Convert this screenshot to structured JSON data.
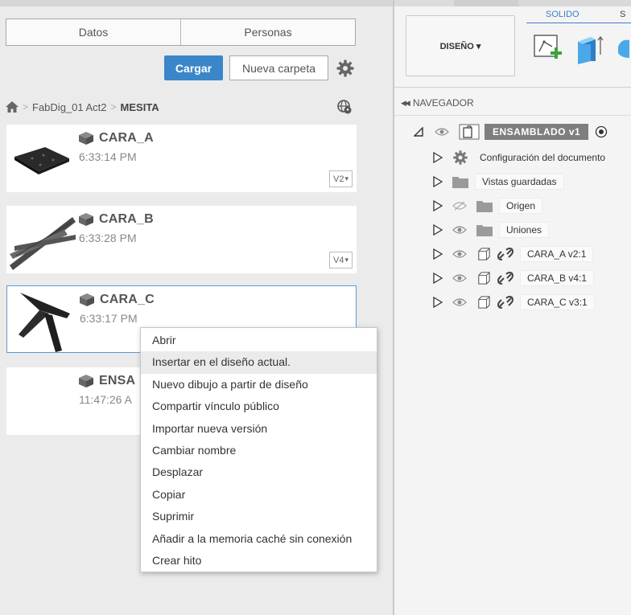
{
  "left_panel": {
    "tabs": [
      {
        "label": "Datos"
      },
      {
        "label": "Personas"
      }
    ],
    "upload_label": "Cargar",
    "new_folder_label": "Nueva carpeta",
    "breadcrumb": {
      "root": "FabDig_01 Act2",
      "current": "MESITA"
    },
    "files": [
      {
        "name": "CARA_A",
        "time": "6:33:14 PM",
        "version": "V2"
      },
      {
        "name": "CARA_B",
        "time": "6:33:28 PM",
        "version": "V4"
      },
      {
        "name": "CARA_C",
        "time": "6:33:17 PM",
        "version": ""
      },
      {
        "name": "ENSA",
        "time": "11:47:26 A",
        "version": ""
      }
    ]
  },
  "context_menu": {
    "items": [
      "Abrir",
      "Insertar en el diseño actual.",
      "Nuevo dibujo a partir de diseño",
      "Compartir vínculo público",
      "Importar nueva versión",
      "Cambiar nombre",
      "Desplazar",
      "Copiar",
      "Suprimir",
      "Añadir a la memoria caché sin conexión",
      "Crear hito"
    ],
    "highlighted_index": 1
  },
  "toolbar": {
    "design_label": "DISEÑO ▾",
    "tab_solid": "SOLIDO",
    "tab_next": "S"
  },
  "navigator": {
    "header": "NAVEGADOR",
    "root": "ENSAMBLADO v1",
    "items": [
      {
        "label": "Configuración del documento",
        "icon": "gear-icon"
      },
      {
        "label": "Vistas guardadas",
        "icon": "folder-icon"
      },
      {
        "label": "Origen",
        "icon": "folder-icon"
      },
      {
        "label": "Uniones",
        "icon": "folder-icon"
      },
      {
        "label": "CARA_A v2:1",
        "icon": "link-icon"
      },
      {
        "label": "CARA_B v4:1",
        "icon": "link-icon"
      },
      {
        "label": "CARA_C v3:1",
        "icon": "link-icon"
      }
    ]
  },
  "colors": {
    "accent": "#3a86c8",
    "selection": "#5b9bd5",
    "root_label_bg": "#7e7e7e"
  }
}
